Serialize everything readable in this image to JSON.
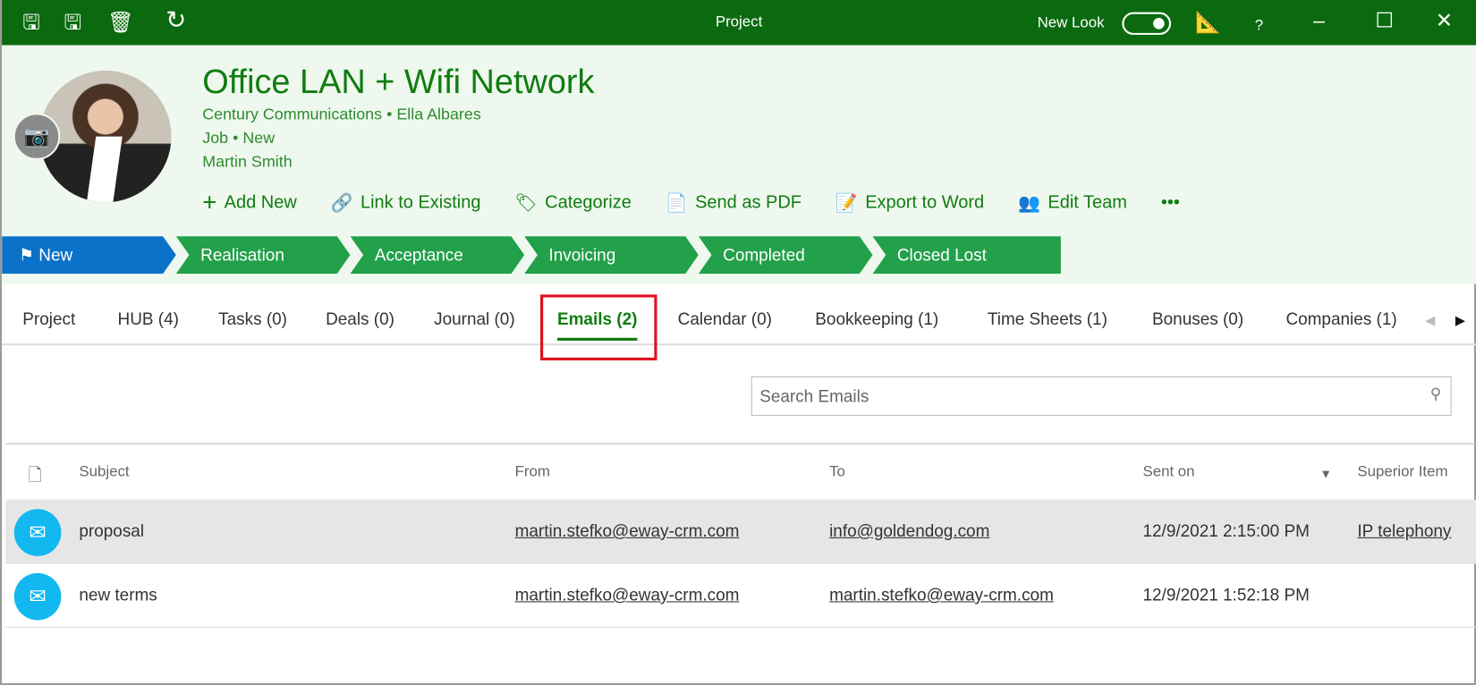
{
  "titlebar": {
    "title": "Project",
    "new_look_label": "New Look",
    "new_look_on": true,
    "icons": [
      "save-close-icon",
      "save-icon",
      "delete-icon",
      "refresh-icon",
      "ruler-icon",
      "help-icon",
      "minimize-icon",
      "maximize-icon",
      "close-icon"
    ],
    "help": "?"
  },
  "header": {
    "title": "Office LAN + Wifi Network",
    "company": "Century Communications",
    "contact": "Ella Albares",
    "type": "Job",
    "status": "New",
    "owner": "Martin Smith",
    "sep": "•"
  },
  "actions": [
    {
      "label": "Add New",
      "icon": "plus-icon"
    },
    {
      "label": "Link to Existing",
      "icon": "link-icon"
    },
    {
      "label": "Categorize",
      "icon": "tag-icon"
    },
    {
      "label": "Send as PDF",
      "icon": "pdf-icon"
    },
    {
      "label": "Export to Word",
      "icon": "word-icon"
    },
    {
      "label": "Edit Team",
      "icon": "team-icon"
    },
    {
      "label": "•••",
      "icon": "more-icon"
    }
  ],
  "stages": [
    "New",
    "Realisation",
    "Acceptance",
    "Invoicing",
    "Completed",
    "Closed Lost"
  ],
  "tabs": [
    "Project",
    "HUB (4)",
    "Tasks (0)",
    "Deals (0)",
    "Journal (0)",
    "Emails (2)",
    "Calendar (0)",
    "Bookkeeping (1)",
    "Time Sheets (1)",
    "Bonuses (0)",
    "Companies (1)"
  ],
  "active_tab": "Emails (2)",
  "search": {
    "placeholder": "Search Emails"
  },
  "table": {
    "columns": [
      "Subject",
      "From",
      "To",
      "Sent on",
      "Superior Item"
    ],
    "sort_column": "Sent on",
    "sort_dir": "desc",
    "rows": [
      {
        "subject": "proposal",
        "from": "martin.stefko@eway-crm.com",
        "to": "info@goldendog.com",
        "sent": "12/9/2021 2:15:00 PM",
        "superior": "IP telephony",
        "selected": true
      },
      {
        "subject": "new terms",
        "from": "martin.stefko@eway-crm.com",
        "to": "martin.stefko@eway-crm.com",
        "sent": "12/9/2021 1:52:18 PM",
        "superior": ""
      }
    ]
  },
  "colors": {
    "titlebar": "#0b6a0f",
    "accent": "#107c10",
    "stage": "#22a04a",
    "stage_active": "#0a72c9",
    "email_icon": "#14b8f0",
    "highlight": "#e0101e"
  }
}
